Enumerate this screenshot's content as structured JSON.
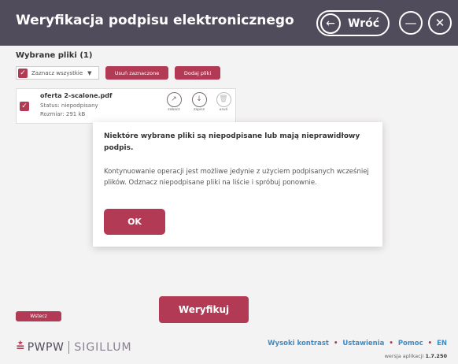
{
  "header": {
    "title": "Weryfikacja podpisu elektronicznego",
    "back_label": "Wróć",
    "back_icon": "arrow-left-icon",
    "minimize_icon": "minimize-icon",
    "close_icon": "close-icon"
  },
  "files_section": {
    "label": "Wybrane pliki",
    "count": "(1)",
    "select_all_label": "Zaznacz wszystkie",
    "remove_selected_label": "Usuń zaznaczone",
    "add_files_label": "Dodaj pliki"
  },
  "file": {
    "name": "oferta 2-scalone.pdf",
    "status": "Status: niepodpisany",
    "size": "Rozmiar: 291 kB",
    "actions": [
      {
        "icon": "open-icon",
        "caption": "zobacz"
      },
      {
        "icon": "download-icon",
        "caption": "zapisz"
      },
      {
        "icon": "trash-icon",
        "caption": "usuń"
      }
    ]
  },
  "dialog": {
    "title": "Niektóre wybrane pliki są niepodpisane lub mają nieprawidłowy podpis.",
    "body": "Kontynuowanie operacji jest możliwe jedynie z użyciem podpisanych wcześniej plików. Odznacz niepodpisane pliki na liście i spróbuj ponownie.",
    "ok_label": "OK"
  },
  "bottom": {
    "small_button_label": "Wstecz",
    "verify_label": "Weryfikuj"
  },
  "footer": {
    "logo_mark": "≛",
    "logo_word": "PWPW",
    "logo_word2": "SIGILLUM",
    "links": [
      "Wysoki kontrast",
      "Ustawienia",
      "Pomoc",
      "EN"
    ],
    "separator": "•",
    "version_label": "wersja aplikacji",
    "version_value": "1.7.250"
  },
  "colors": {
    "header_bg": "#514c5c",
    "accent": "#b23a55",
    "link": "#3d8bc4"
  }
}
